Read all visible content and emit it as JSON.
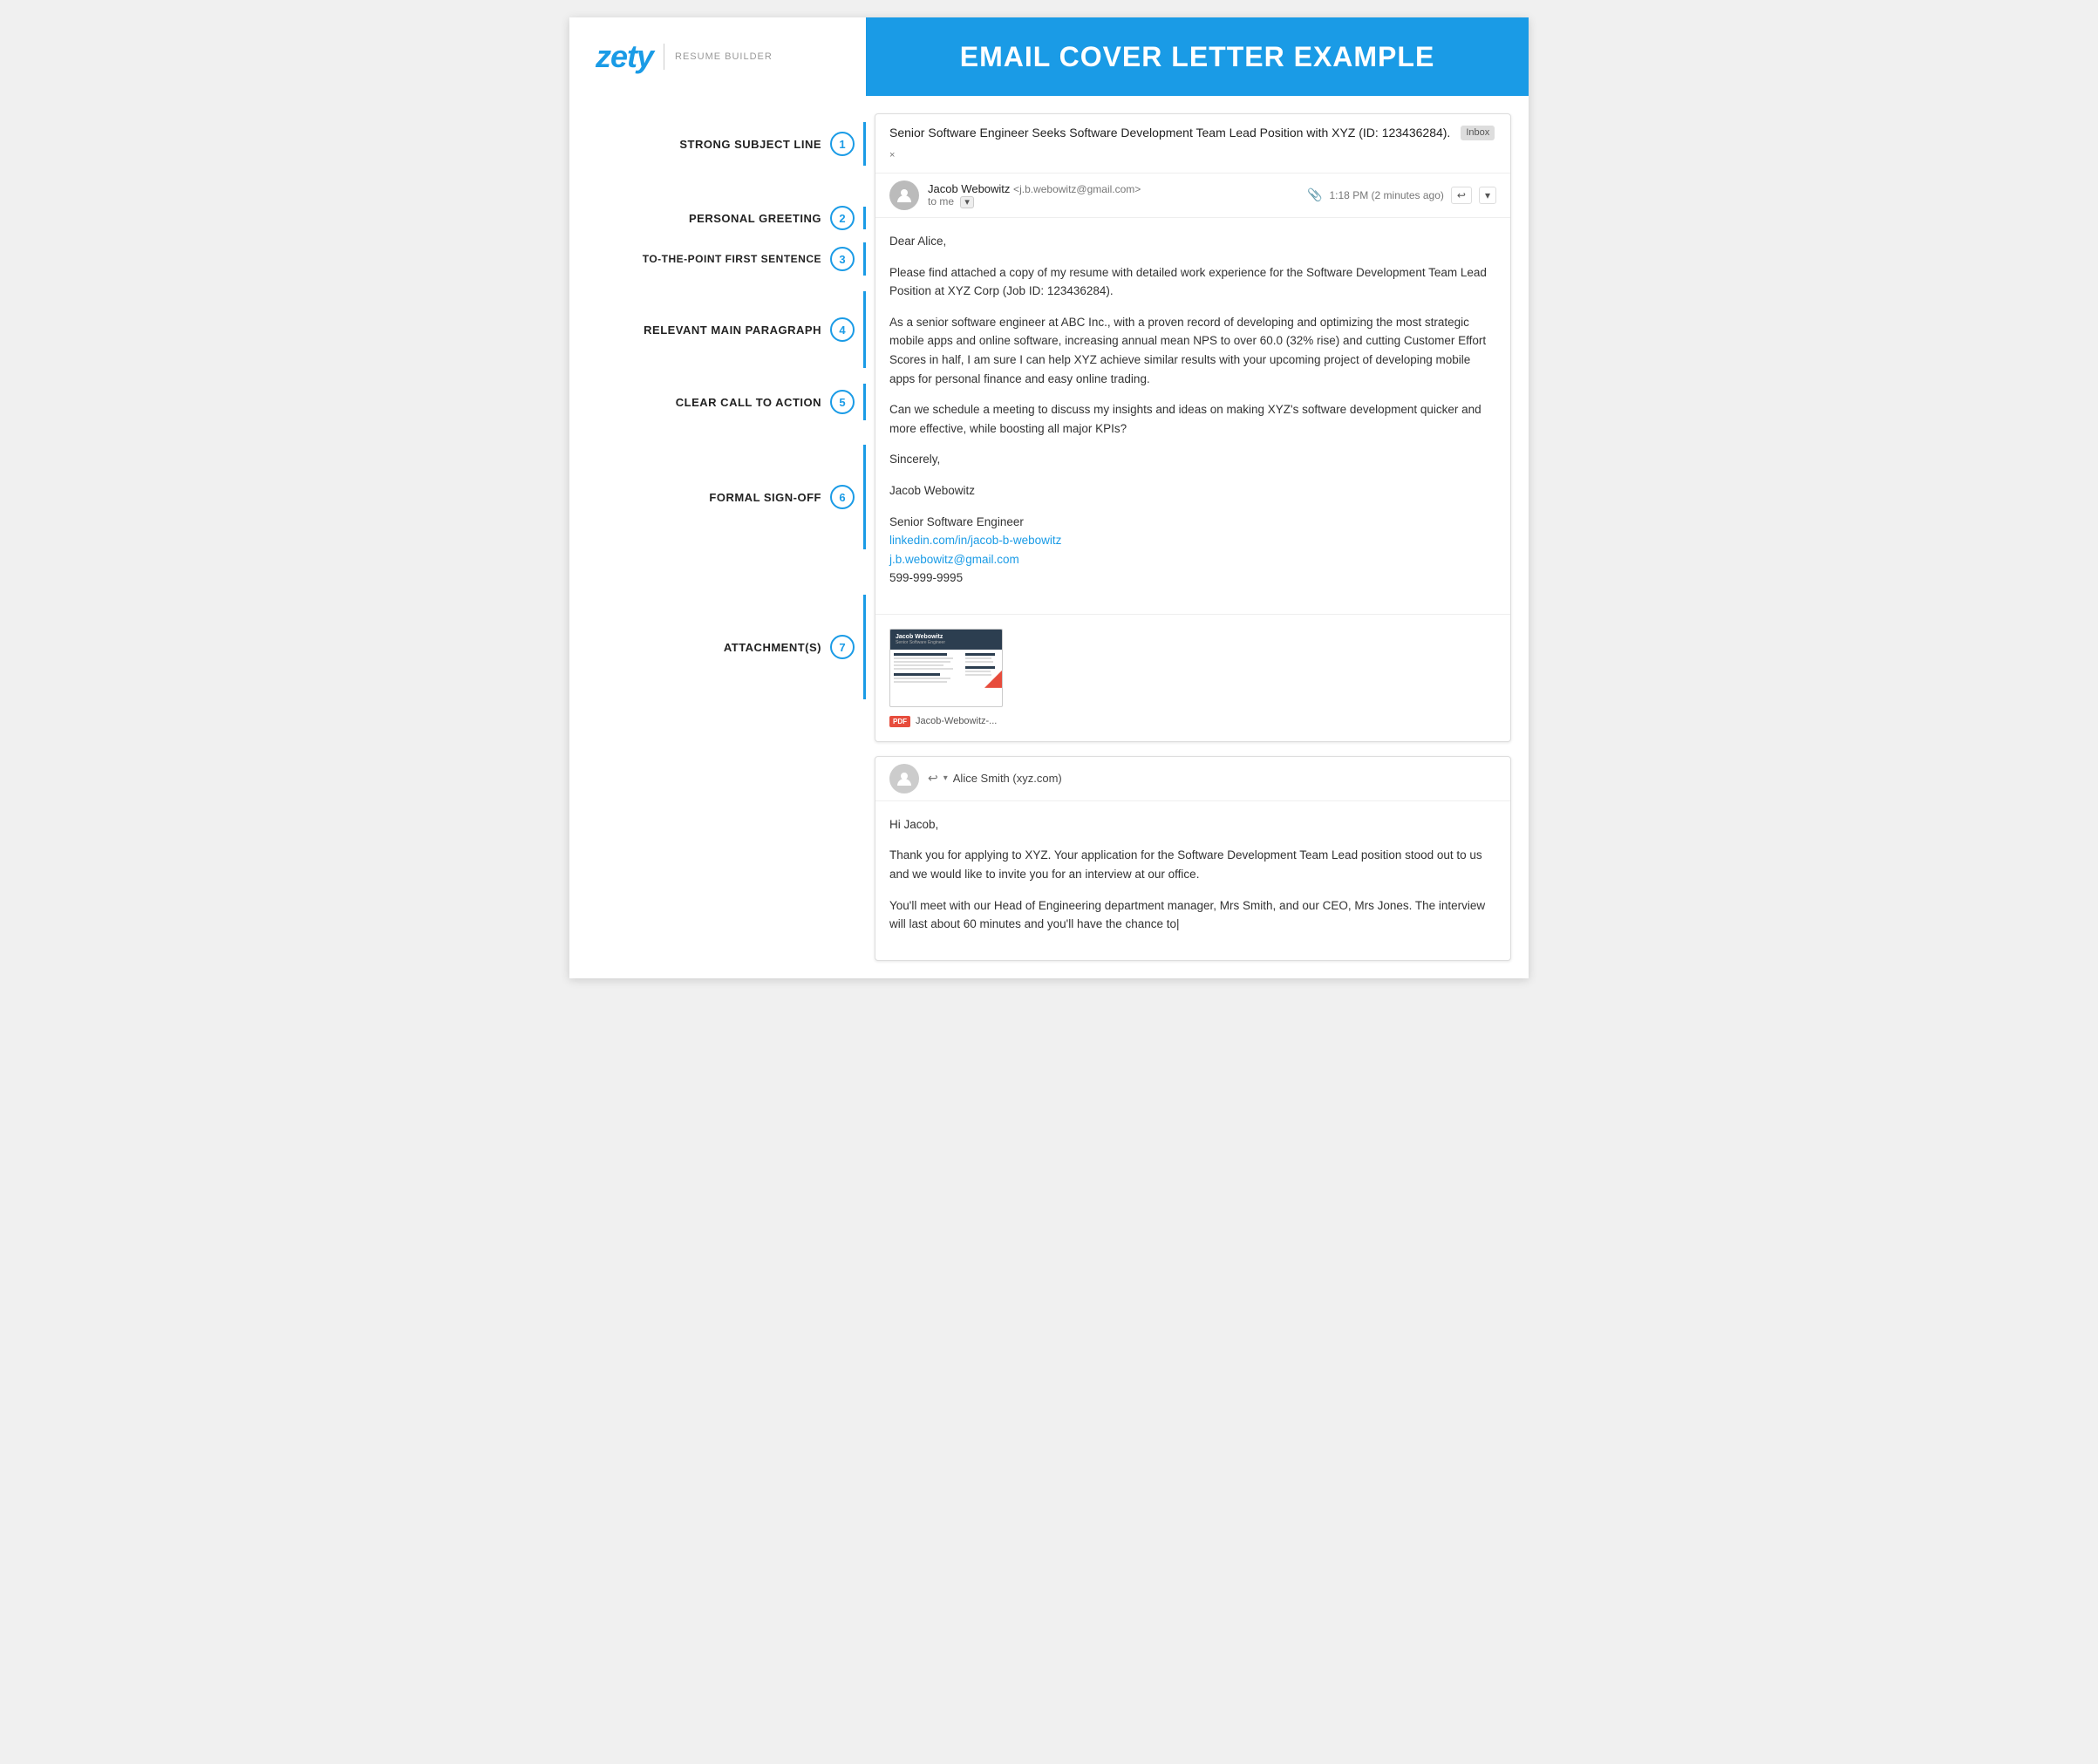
{
  "header": {
    "logo_text": "zety",
    "logo_sub": "RESUME BUILDER",
    "title": "EMAIL COVER LETTER EXAMPLE"
  },
  "sidebar": {
    "items": [
      {
        "num": "1",
        "label": "STRONG SUBJECT LINE"
      },
      {
        "num": "2",
        "label": "PERSONAL GREETING"
      },
      {
        "num": "3",
        "label": "TO-THE-POINT FIRST SENTENCE"
      },
      {
        "num": "4",
        "label": "RELEVANT MAIN PARAGRAPH"
      },
      {
        "num": "5",
        "label": "CLEAR CALL TO ACTION"
      },
      {
        "num": "6",
        "label": "FORMAL SIGN-OFF"
      },
      {
        "num": "7",
        "label": "ATTACHMENT(S)"
      }
    ]
  },
  "email": {
    "subject": "Senior Software Engineer Seeks Software Development Team Lead Position with XYZ (ID: 123436284).",
    "inbox_badge": "Inbox",
    "from_name": "Jacob Webowitz",
    "from_email": "j.b.webowitz@gmail.com",
    "to": "to me",
    "time": "1:18 PM (2 minutes ago)",
    "greeting": "Dear Alice,",
    "para1": "Please find attached a copy of my resume with detailed work experience for the Software Development Team Lead Position at XYZ Corp (Job ID: 123436284).",
    "para2": "As a senior software engineer at ABC Inc., with a proven record of developing and optimizing the most strategic mobile apps and online software, increasing annual mean NPS to over 60.0 (32% rise) and cutting Customer Effort Scores in half, I am sure I can help XYZ achieve similar results with your upcoming project of developing mobile apps for personal finance and easy online trading.",
    "para3": "Can we schedule a meeting to discuss my insights and ideas on making XYZ's software development quicker and more effective, while boosting all major KPIs?",
    "closing": "Sincerely,",
    "sign_name": "Jacob Webowitz",
    "sign_title": "Senior Software Engineer",
    "linkedin_url": "linkedin.com/in/jacob-b-webowitz",
    "email_addr": "j.b.webowitz@gmail.com",
    "phone": "599-999-9995",
    "pdf_filename": "Jacob-Webowitz-...",
    "resume_name": "Jacob Webowitz",
    "resume_title": "Senior Software Engineer"
  },
  "reply": {
    "from": "Alice Smith (xyz.com)",
    "greeting": "Hi Jacob,",
    "para1": "Thank you for applying to XYZ. Your application for the Software Development Team Lead position stood out to us and we would like to invite you for an interview at our office.",
    "para2": "You'll meet with our Head of Engineering department manager, Mrs Smith, and our CEO, Mrs Jones. The interview will last about 60 minutes and you'll have the chance to|"
  },
  "colors": {
    "blue": "#1a9be6",
    "dark": "#222222",
    "light_gray": "#f5f5f5",
    "border": "#dddddd"
  }
}
